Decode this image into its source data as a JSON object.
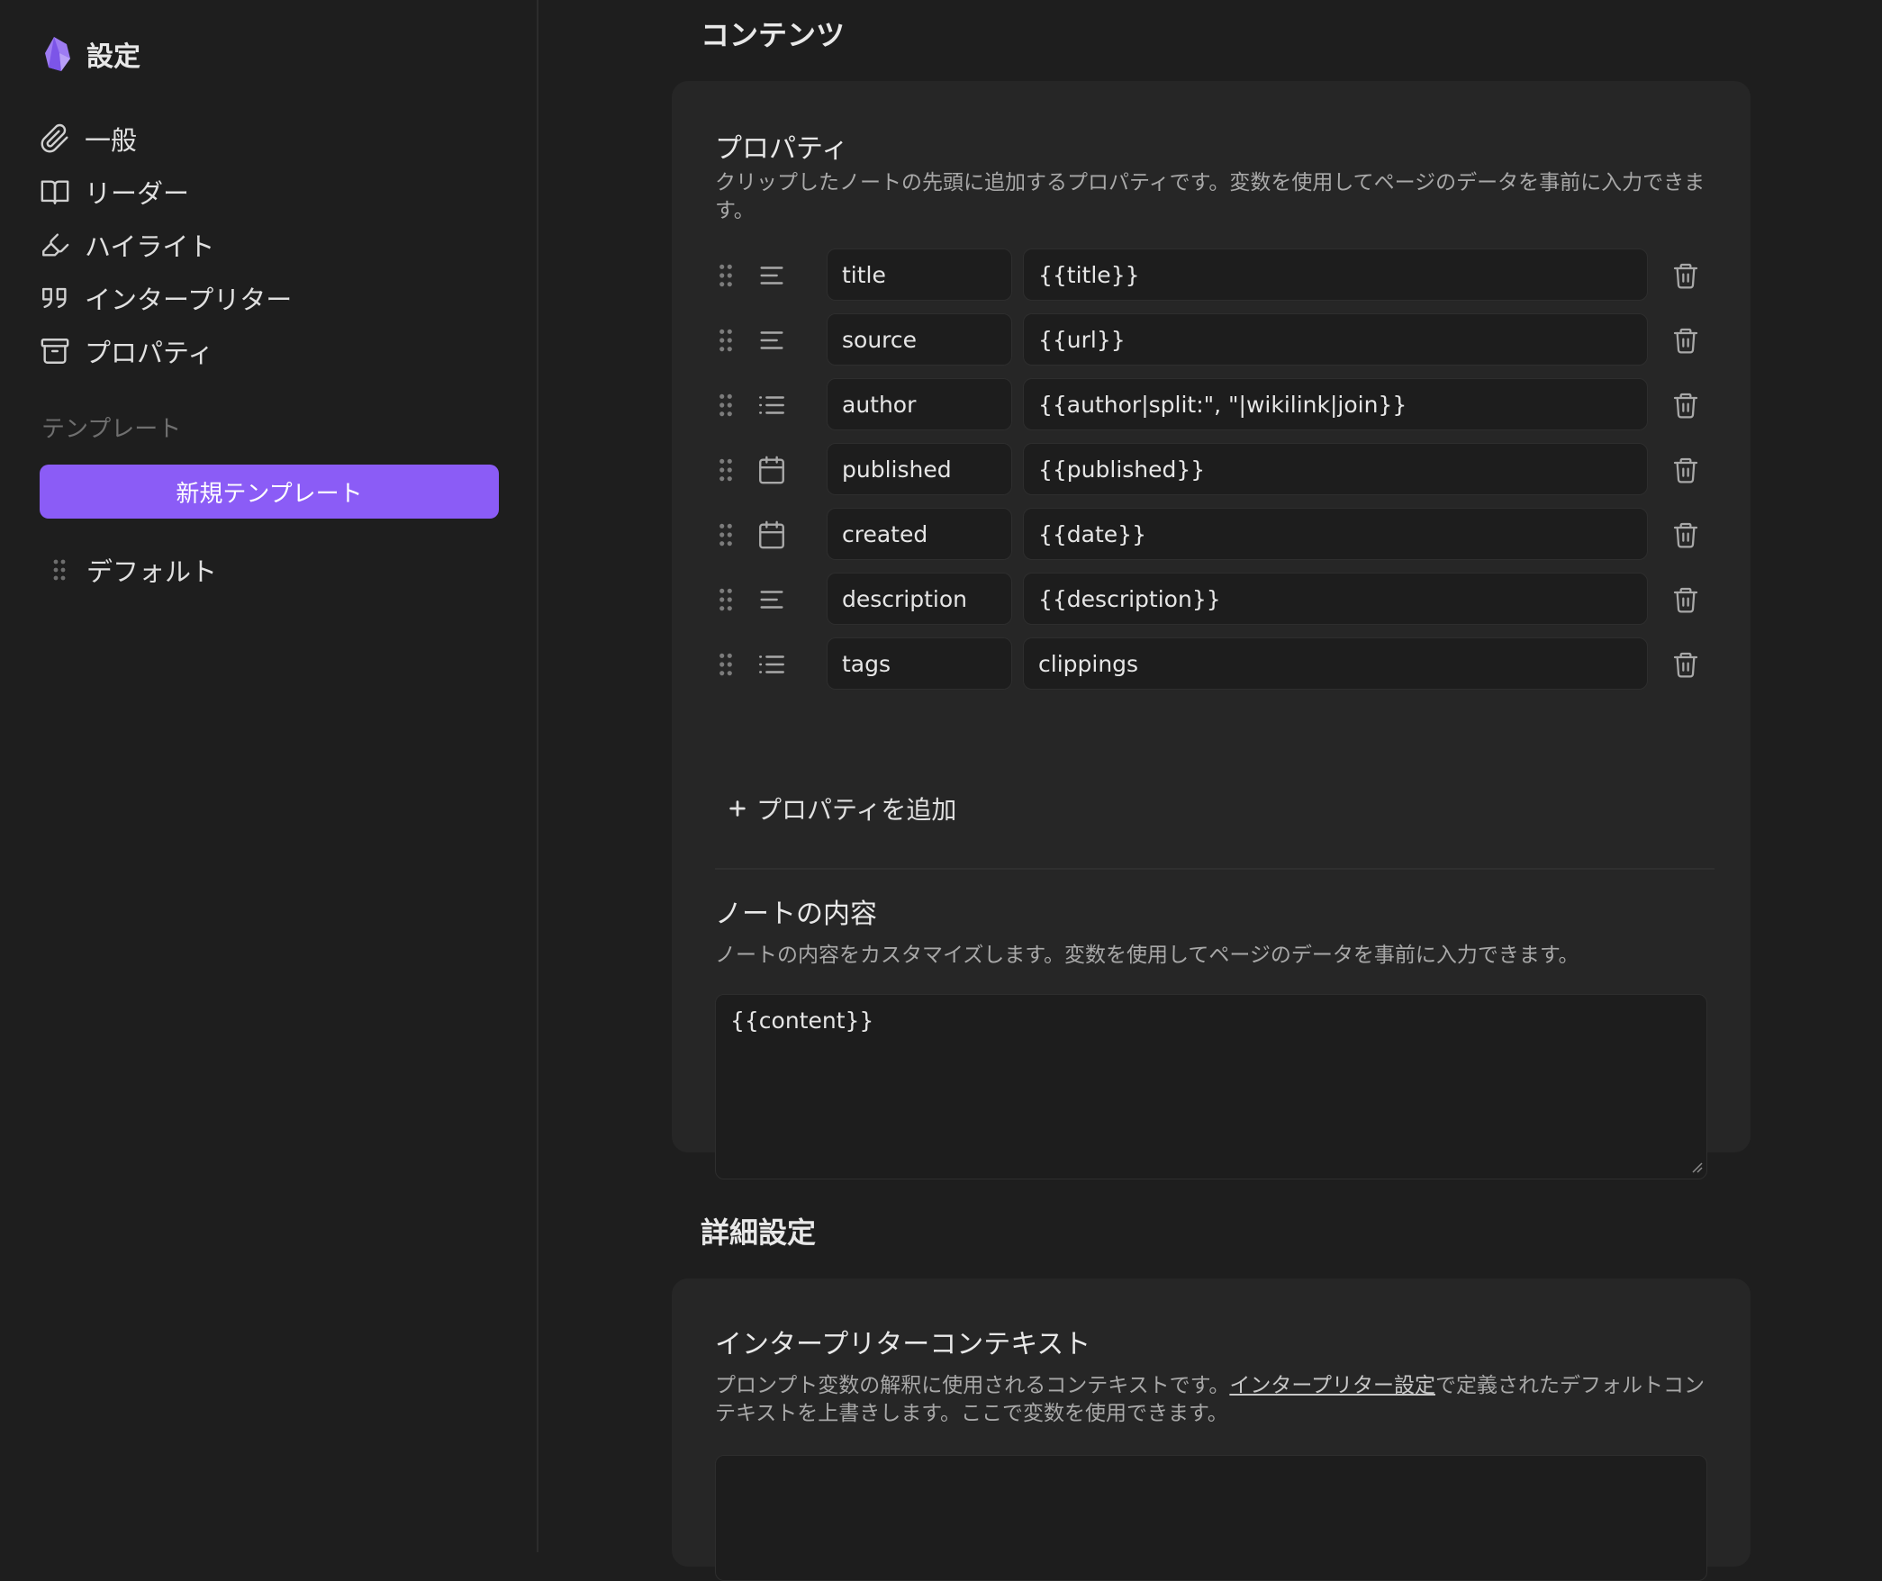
{
  "sidebar": {
    "title": "設定",
    "nav": [
      {
        "label": "一般",
        "icon": "paperclip-icon"
      },
      {
        "label": "リーダー",
        "icon": "book-open-icon"
      },
      {
        "label": "ハイライト",
        "icon": "highlighter-icon"
      },
      {
        "label": "インタープリター",
        "icon": "quote-icon"
      },
      {
        "label": "プロパティ",
        "icon": "archive-icon"
      }
    ],
    "templates_label": "テンプレート",
    "new_template_button": "新規テンプレート",
    "templates": [
      {
        "label": "デフォルト"
      }
    ]
  },
  "main": {
    "content_heading": "コンテンツ",
    "properties": {
      "title": "プロパティ",
      "description": "クリップしたノートの先頭に追加するプロパティです。変数を使用してページのデータを事前に入力できます。",
      "rows": [
        {
          "key": "title",
          "value": "{{title}}",
          "type_icon": "text-icon"
        },
        {
          "key": "source",
          "value": "{{url}}",
          "type_icon": "text-icon"
        },
        {
          "key": "author",
          "value": "{{author|split:\", \"|wikilink|join}}",
          "type_icon": "list-icon"
        },
        {
          "key": "published",
          "value": "{{published}}",
          "type_icon": "calendar-icon"
        },
        {
          "key": "created",
          "value": "{{date}}",
          "type_icon": "calendar-icon"
        },
        {
          "key": "description",
          "value": "{{description}}",
          "type_icon": "text-icon"
        },
        {
          "key": "tags",
          "value": "clippings",
          "type_icon": "list-icon"
        }
      ],
      "add_button": "プロパティを追加"
    },
    "note_content": {
      "title": "ノートの内容",
      "description": "ノートの内容をカスタマイズします。変数を使用してページのデータを事前に入力できます。",
      "value": "{{content}}"
    },
    "advanced_heading": "詳細設定",
    "interpreter_context": {
      "title": "インタープリターコンテキスト",
      "description_before": "プロンプト変数の解釈に使用されるコンテキストです。",
      "link_text": "インタープリター設定",
      "description_after": "で定義されたデフォルトコンテキストを上書きします。ここで変数を使用できます。",
      "value": ""
    }
  },
  "colors": {
    "accent": "#8b5cf6",
    "background": "#1e1e1e",
    "card": "#262626"
  }
}
